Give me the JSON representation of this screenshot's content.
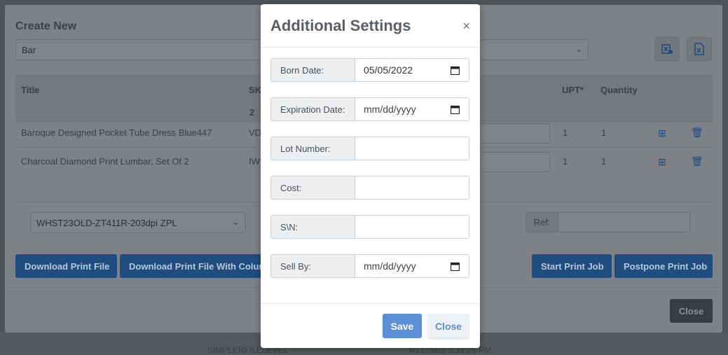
{
  "background": {
    "panel_title": "Create New",
    "type_select": "Bar",
    "icons": [
      "excel-settings-icon",
      "excel-icon"
    ],
    "table": {
      "headers": [
        "Title",
        "SK",
        "UPT*",
        "Quantity"
      ],
      "subheader_value": "2",
      "rows": [
        {
          "title": "Baroque Designed Pocket Tube Dress Blue447",
          "sku": "VD",
          "upt": "1",
          "qty": "1"
        },
        {
          "title": "Charcoal Diamond Print Lumbar, Set Of 2",
          "sku": "IW",
          "upt": "1",
          "qty": "1"
        }
      ]
    },
    "printer_select": "WHST23OLD-ZT411R-203dpi ZPL",
    "ref_label": "Ref:",
    "buttons": {
      "download": "Download Print File",
      "download_cols": "Download Print File With Colur",
      "start": "Start Print Job",
      "postpone": "Postpone Print Job",
      "close": "Close"
    },
    "strip": {
      "text_a": "SIMPLERFILELEVEL",
      "text_b": "4/21/2022 3:31:26 PM"
    }
  },
  "modal": {
    "title": "Additional Settings",
    "close_glyph": "×",
    "fields": [
      {
        "label": "Born Date:",
        "value": "05/05/2022",
        "type": "date"
      },
      {
        "label": "Expiration Date:",
        "value": "mm/dd/yyyy",
        "type": "date"
      },
      {
        "label": "Lot Number:",
        "value": "",
        "type": "text"
      },
      {
        "label": "Cost:",
        "value": "",
        "type": "text"
      },
      {
        "label": "S\\N:",
        "value": "",
        "type": "text"
      },
      {
        "label": "Sell By:",
        "value": "mm/dd/yyyy",
        "type": "date"
      }
    ],
    "save_label": "Save",
    "close_label": "Close"
  },
  "colors": {
    "primary": "#5b8fd6",
    "overlay_primary": "#1f4d80"
  }
}
